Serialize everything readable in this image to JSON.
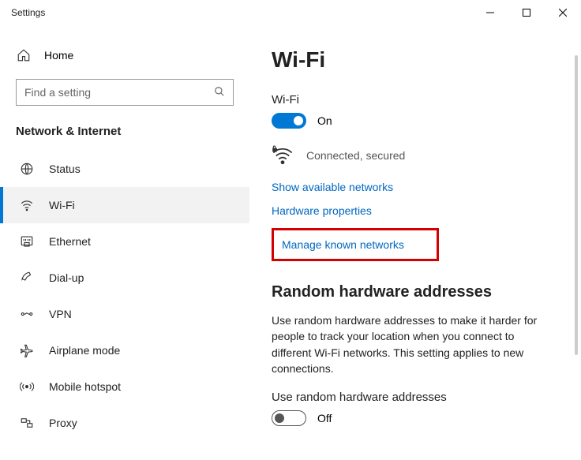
{
  "titlebar": {
    "title": "Settings"
  },
  "home": {
    "label": "Home"
  },
  "search": {
    "placeholder": "Find a setting"
  },
  "category": {
    "label": "Network & Internet"
  },
  "nav": {
    "items": [
      {
        "label": "Status"
      },
      {
        "label": "Wi-Fi"
      },
      {
        "label": "Ethernet"
      },
      {
        "label": "Dial-up"
      },
      {
        "label": "VPN"
      },
      {
        "label": "Airplane mode"
      },
      {
        "label": "Mobile hotspot"
      },
      {
        "label": "Proxy"
      }
    ]
  },
  "page": {
    "title": "Wi-Fi",
    "wifi_label": "Wi-Fi",
    "wifi_state": "On",
    "connection_status": "Connected, secured",
    "link_available": "Show available networks",
    "link_hardware": "Hardware properties",
    "link_manage": "Manage known networks",
    "random_title": "Random hardware addresses",
    "random_body": "Use random hardware addresses to make it harder for people to track your location when you connect to different Wi-Fi networks. This setting applies to new connections.",
    "random_toggle_label": "Use random hardware addresses",
    "random_toggle_state": "Off"
  }
}
